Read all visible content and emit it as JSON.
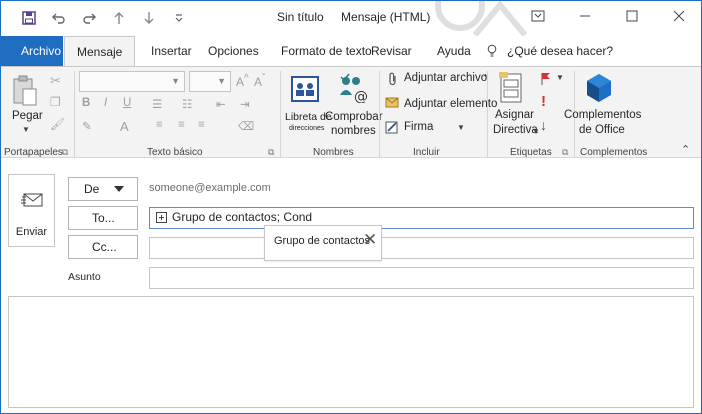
{
  "window": {
    "title": "Sin título",
    "subtitle": "Mensaje (HTML)",
    "minimize_icon": "minimize-icon",
    "restore_icon": "restore-icon",
    "close_icon": "close-icon",
    "ribbon_display_icon": "ribbon-display-icon"
  },
  "quick_access": {
    "save_icon": "save-icon",
    "undo_icon": "undo-icon",
    "redo_icon": "redo-icon",
    "up_icon": "arrow-up-icon",
    "down_icon": "arrow-down-icon",
    "customize_icon": "customize-qat-icon"
  },
  "tabs": [
    {
      "label": "Archivo"
    },
    {
      "label": "Mensaje"
    },
    {
      "label": "Insertar"
    },
    {
      "label": "Opciones"
    },
    {
      "label": "Formato de texto"
    },
    {
      "label": "Revisar"
    },
    {
      "label": "Ayuda"
    }
  ],
  "tell_me": "¿Qué desea hacer?",
  "ribbon": {
    "clipboard": {
      "label": "Portapapeles",
      "paste": "Pegar"
    },
    "basic_text": {
      "label": "Texto básico",
      "bold": "B",
      "italic": "I",
      "underline": "U",
      "highlight": "A"
    },
    "names": {
      "label": "Nombres",
      "address_book_line1": "Libreta de",
      "address_book_line2": "direcciones",
      "check_names_line1": "Comprobar",
      "check_names_line2": "nombres"
    },
    "include": {
      "label": "Incluir",
      "attach_file": "Adjuntar archivo",
      "attach_item": "Adjuntar elemento",
      "signature": "Firma"
    },
    "tags": {
      "label": "Etiquetas",
      "assign_policy_line1": "Asignar",
      "assign_policy_line2": "Directiva"
    },
    "addins": {
      "label": "Complementos",
      "office_addins_line1": "Complementos",
      "office_addins_line2": "de Office"
    }
  },
  "compose": {
    "send": "Enviar",
    "from_btn": "De",
    "from_address": "someone@example.com",
    "to_btn": "To...",
    "to_value": "Grupo de contactos; Cond",
    "cc_btn": "Cc...",
    "subject_label": "Asunto",
    "suggestion": "Grupo de contactos"
  },
  "colors": {
    "accent": "#1f6dc0",
    "ribbon_bg": "#f3f3f3"
  }
}
